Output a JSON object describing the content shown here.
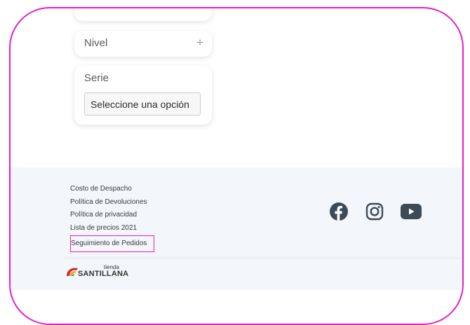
{
  "filters": {
    "nivel_label": "Nivel",
    "nivel_toggle": "+",
    "serie_label": "Serie",
    "serie_select_value": "Seleccione una opción"
  },
  "footer": {
    "links": [
      "Costo de Despacho",
      "Política de Devoluciones",
      "Política de privacidad",
      "Lista de precios 2021",
      "Seguimiento de Pedidos"
    ],
    "social_icons": [
      "facebook-icon",
      "instagram-icon",
      "youtube-icon"
    ],
    "logo": {
      "small_text": "tienda",
      "brand_text": "SANTILLANA"
    }
  },
  "colors": {
    "highlight": "#e61ec8",
    "footer_bg": "#f3f6fb",
    "icon": "#3d4a57"
  }
}
